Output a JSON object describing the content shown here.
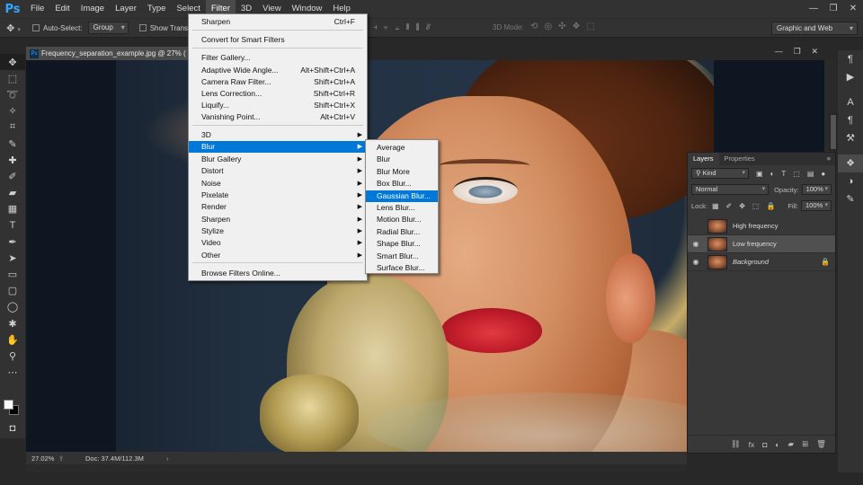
{
  "app": {
    "logo": "Ps",
    "menu": [
      "File",
      "Edit",
      "Image",
      "Layer",
      "Type",
      "Select",
      "Filter",
      "3D",
      "View",
      "Window",
      "Help"
    ],
    "window_controls": [
      "—",
      "❐",
      "✕"
    ]
  },
  "options_bar": {
    "move_icon": "move-tool-icon",
    "auto_select_label": "Auto-Select:",
    "auto_select_value": "Group",
    "show_transform_label": "Show Transf",
    "mode_3d_label": "3D Mode:",
    "workspace": "Graphic and Web"
  },
  "document": {
    "tab_title": "Frequency_separation_example.jpg @ 27% (",
    "zoom": "27.02%",
    "doc_info": "Doc: 37.4M/112.3M",
    "status_arrow": "›",
    "doc_controls": [
      "—",
      "❐",
      "✕"
    ]
  },
  "filter_menu": {
    "items": [
      {
        "label": "Sharpen",
        "shortcut": "Ctrl+F"
      },
      {
        "label": "Convert for Smart Filters",
        "shortcut": ""
      },
      {
        "label": "Filter Gallery...",
        "shortcut": ""
      },
      {
        "label": "Adaptive Wide Angle...",
        "shortcut": "Alt+Shift+Ctrl+A"
      },
      {
        "label": "Camera Raw Filter...",
        "shortcut": "Shift+Ctrl+A"
      },
      {
        "label": "Lens Correction...",
        "shortcut": "Shift+Ctrl+R"
      },
      {
        "label": "Liquify...",
        "shortcut": "Shift+Ctrl+X"
      },
      {
        "label": "Vanishing Point...",
        "shortcut": "Alt+Ctrl+V"
      },
      {
        "label": "3D",
        "shortcut": ""
      },
      {
        "label": "Blur",
        "shortcut": ""
      },
      {
        "label": "Blur Gallery",
        "shortcut": ""
      },
      {
        "label": "Distort",
        "shortcut": ""
      },
      {
        "label": "Noise",
        "shortcut": ""
      },
      {
        "label": "Pixelate",
        "shortcut": ""
      },
      {
        "label": "Render",
        "shortcut": ""
      },
      {
        "label": "Sharpen",
        "shortcut": ""
      },
      {
        "label": "Stylize",
        "shortcut": ""
      },
      {
        "label": "Video",
        "shortcut": ""
      },
      {
        "label": "Other",
        "shortcut": ""
      },
      {
        "label": "Browse Filters Online...",
        "shortcut": ""
      }
    ],
    "submenu_arrow": "▶"
  },
  "blur_menu": {
    "items": [
      "Average",
      "Blur",
      "Blur More",
      "Box Blur...",
      "Gaussian Blur...",
      "Lens Blur...",
      "Motion Blur...",
      "Radial Blur...",
      "Shape Blur...",
      "Smart Blur...",
      "Surface Blur..."
    ],
    "highlighted": "Gaussian Blur..."
  },
  "layers_panel": {
    "tabs": [
      "Layers",
      "Properties"
    ],
    "panel_menu": "≡",
    "filter_kind": "Kind",
    "blend_mode": "Normal",
    "opacity_label": "Opacity:",
    "opacity_value": "100%",
    "lock_label": "Lock:",
    "fill_label": "Fill:",
    "fill_value": "100%",
    "layers": [
      {
        "name": "High frequency",
        "visible": false,
        "selected": false,
        "locked": false
      },
      {
        "name": "Low frequency",
        "visible": true,
        "selected": true,
        "locked": false
      },
      {
        "name": "Background",
        "visible": true,
        "selected": false,
        "locked": true
      }
    ],
    "eye_glyph": "◉",
    "lock_glyph": "🔒"
  },
  "colors": {
    "accent": "#0078d7",
    "ps_blue": "#31a8ff",
    "panel_bg": "#383838",
    "chrome_bg": "#323232"
  }
}
